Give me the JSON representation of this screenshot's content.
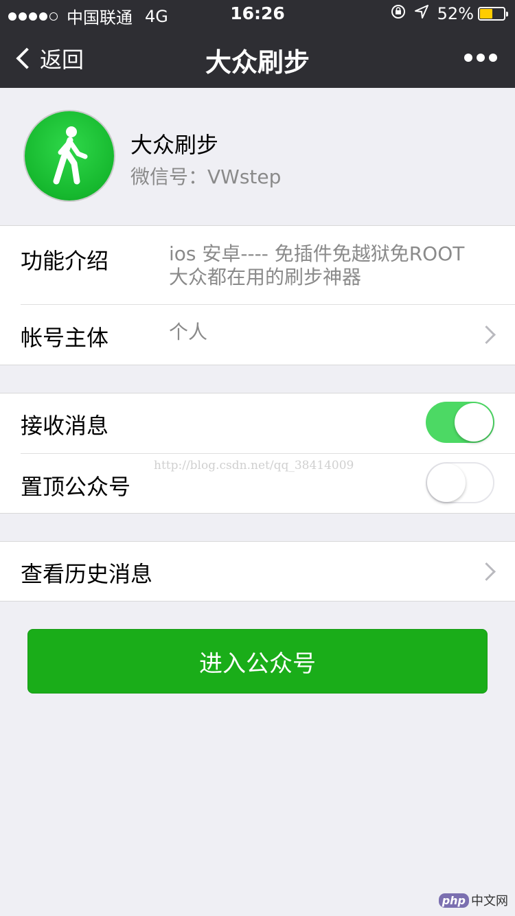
{
  "status_bar": {
    "carrier": "中国联通",
    "network": "4G",
    "time": "16:26",
    "battery": "52%",
    "battery_level": 0.52
  },
  "nav": {
    "back_label": "返回",
    "title": "大众刷步",
    "more_icon": "more-dots-icon"
  },
  "profile": {
    "name": "大众刷步",
    "wechat_id": "微信号：VWstep",
    "avatar_icon": "walking-person-icon"
  },
  "info": {
    "intro_label": "功能介绍",
    "intro_line1": "ios 安卓---- 免插件免越狱免ROOT",
    "intro_line2": "大众都在用的刷步神器",
    "account_label": "帐号主体",
    "account_value": "个人"
  },
  "settings": {
    "receive_label": "接收消息",
    "receive_on": true,
    "pin_label": "置顶公众号",
    "pin_on": false
  },
  "history": {
    "label": "查看历史消息"
  },
  "watermark": "http://blog.csdn.net/qq_38414009",
  "enter_button": "进入公众号",
  "footer": {
    "badge": "php",
    "text": "中文网"
  },
  "colors": {
    "nav_bg": "#2e2e33",
    "accent_green": "#1aad19",
    "toggle_on": "#4cd964",
    "battery": "#ffcc00"
  }
}
